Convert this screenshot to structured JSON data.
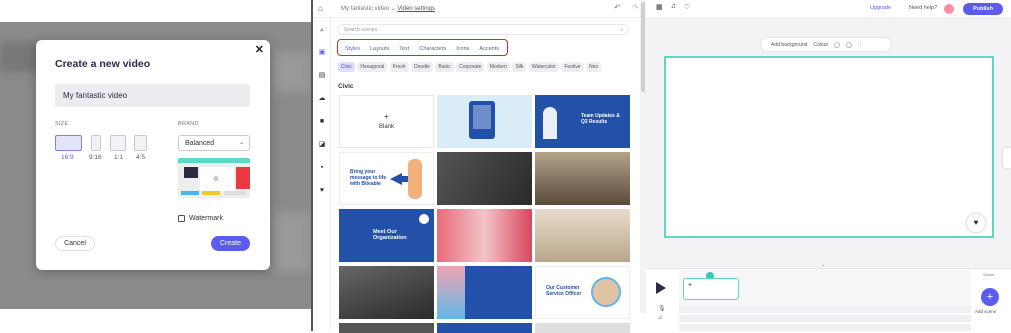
{
  "modal": {
    "title": "Create a new video",
    "name_value": "My fantastic video",
    "size_label": "SIZE",
    "brand_label": "BRAND",
    "sizes": [
      "16:9",
      "9:16",
      "1:1",
      "4:5"
    ],
    "brand_value": "Balanced",
    "watermark_label": "Watermark",
    "cancel_label": "Cancel",
    "create_label": "Create"
  },
  "topbar": {
    "project": "My fantastic video",
    "settings": "Video settings",
    "upgrade": "Upgrade",
    "help": "Need help?",
    "publish": "Publish"
  },
  "panel": {
    "search_placeholder": "Search scenes",
    "tabs": [
      "Styles",
      "Layouts",
      "Text",
      "Characters",
      "Icons",
      "Accents"
    ],
    "chips": [
      "Civic",
      "Hexagonal",
      "Fresh",
      "Doodle",
      "Basic",
      "Corporate",
      "Modern",
      "Silk",
      "Watercolor",
      "Festive",
      "Neo"
    ],
    "section": "Civic",
    "cards": {
      "blank": "Blank",
      "team": "Team Updates & Q2 Results",
      "bring": "Bring your message to life with Biteable",
      "meet": "Meet Our Organization",
      "officer": "Our Customer Service Officer"
    }
  },
  "stage": {
    "add_background": "Add background",
    "colour": "Colour"
  },
  "timeline": {
    "add_scene": "Add scene",
    "scene_label": "Scene"
  },
  "colors": {
    "accent": "#5b5bf0",
    "canvas_border": "#5fd6c6",
    "highlight": "#e2252b",
    "card_blue": "#2350a8"
  }
}
